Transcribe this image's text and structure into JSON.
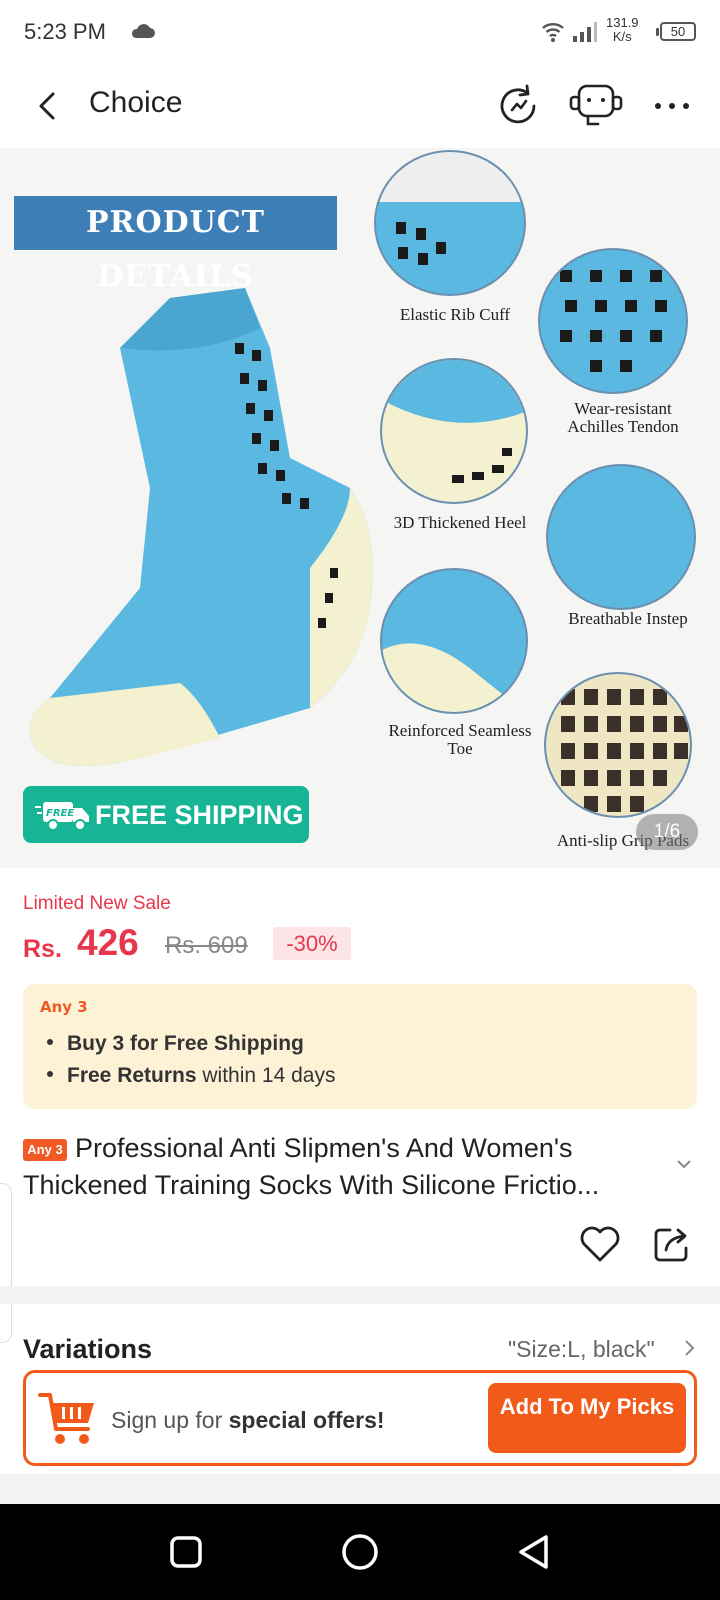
{
  "status_bar": {
    "time": "5:23 PM",
    "net_speed_value": "131.9",
    "net_speed_unit": "K/s",
    "battery": "50"
  },
  "header": {
    "title": "Choice",
    "icons": [
      "back-icon",
      "refresh-icon",
      "support-robot-icon",
      "more-icon"
    ]
  },
  "hero": {
    "banner": "PRODUCT DETAILS",
    "features": [
      "Elastic Rib Cuff",
      "Wear-resistant Achilles Tendon",
      "3D Thickened Heel",
      "Breathable Instep",
      "Reinforced Seamless Toe",
      "Anti-slip Grip Pads"
    ],
    "free_shipping": "FREE SHIPPING",
    "free_badge": "FREE",
    "page_indicator": "1/6",
    "sock_color": "#5bb8e0",
    "sole_color": "#f4f1d0"
  },
  "price": {
    "sale_label": "Limited New Sale",
    "currency": "Rs.",
    "current": "426",
    "original": "Rs. 609",
    "discount": "-30%"
  },
  "promo": {
    "badge": "Any 3",
    "line1_bold": "Buy 3 for  Free Shipping",
    "line2_bold": "Free Returns",
    "line2_rest": " within 14 days"
  },
  "product": {
    "badge": "Any 3",
    "title": "Professional Anti Slipmen's And Women's Thickened Training Socks With Silicone Frictio..."
  },
  "variations": {
    "title": "Variations",
    "value": "\"Size:L, black\""
  },
  "signup": {
    "text_prefix": "Sign up for ",
    "text_bold": "special offers!",
    "button": "Add To My Picks"
  },
  "colors": {
    "accent_red": "#e8364c",
    "accent_orange": "#f25a1a",
    "teal": "#17b596"
  }
}
